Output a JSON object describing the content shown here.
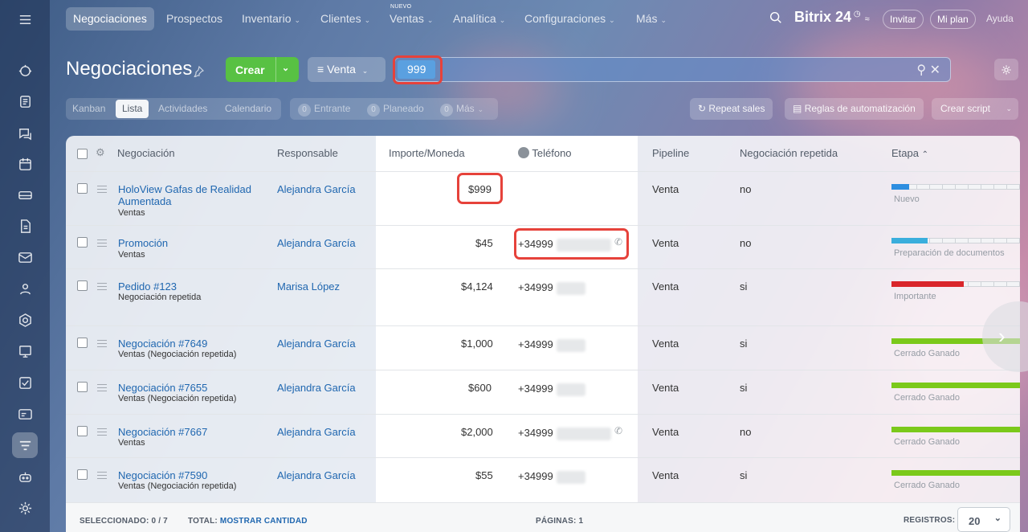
{
  "topnav": {
    "items": [
      {
        "label": "Negociaciones",
        "chevron": false
      },
      {
        "label": "Prospectos",
        "chevron": false
      },
      {
        "label": "Inventario",
        "chevron": true
      },
      {
        "label": "Clientes",
        "chevron": true
      },
      {
        "label": "Ventas",
        "chevron": true,
        "badge": "NUEVO"
      },
      {
        "label": "Analítica",
        "chevron": true
      },
      {
        "label": "Configuraciones",
        "chevron": true
      },
      {
        "label": "Más",
        "chevron": true
      }
    ],
    "brand": "Bitrix 24",
    "invite": "Invitar",
    "plan": "Mi plan",
    "help": "Ayuda"
  },
  "toolbar": {
    "title": "Negociaciones",
    "create_label": "Crear",
    "pipeline_label": "Venta",
    "search_value": "999"
  },
  "views": {
    "tabs": [
      "Kanban",
      "Lista",
      "Actividades",
      "Calendario"
    ],
    "active": "Lista",
    "counters": [
      {
        "num": "0",
        "label": "Entrante"
      },
      {
        "num": "0",
        "label": "Planeado"
      },
      {
        "num": "0",
        "label": "Más"
      }
    ],
    "repeat_sales": "Repeat sales",
    "automation": "Reglas de automatización",
    "create_script": "Crear script"
  },
  "table": {
    "headers": {
      "deal": "Negociación",
      "responsible": "Responsable",
      "amount": "Importe/Moneda",
      "phone": "Teléfono",
      "pipeline": "Pipeline",
      "repeat": "Negociación repetida",
      "stage": "Etapa"
    },
    "rows": [
      {
        "title": "HoloView Gafas de Realidad",
        "title2": "Aumentada",
        "sub": "Ventas",
        "responsible": "Alejandra García",
        "amount": "$999",
        "phone": "",
        "pipeline": "Venta",
        "repeat": "no",
        "stage": "Nuevo",
        "stage_color": "#2d8ee0",
        "stage_fill": 0.14
      },
      {
        "title": "Promoción",
        "title2": "",
        "sub": "Ventas",
        "responsible": "Alejandra García",
        "amount": "$45",
        "phone": "+34999",
        "pipeline": "Venta",
        "repeat": "no",
        "stage": "Preparación de documentos",
        "stage_color": "#3aaedc",
        "stage_fill": 0.28
      },
      {
        "title": "Pedido #123",
        "title2": "",
        "sub": "Negociación repetida",
        "responsible": "Marisa López",
        "amount": "$4,124",
        "phone": "+34999",
        "pipeline": "Venta",
        "repeat": "si",
        "stage": "Importante",
        "stage_color": "#d9262b",
        "stage_fill": 0.56
      },
      {
        "title": "Negociación #7649",
        "title2": "",
        "sub": "Ventas (Negociación repetida)",
        "responsible": "Alejandra García",
        "amount": "$1,000",
        "phone": "+34999",
        "pipeline": "Venta",
        "repeat": "si",
        "stage": "Cerrado Ganado",
        "stage_color": "#7bc91b",
        "stage_fill": 1
      },
      {
        "title": "Negociación #7655",
        "title2": "",
        "sub": "Ventas (Negociación repetida)",
        "responsible": "Alejandra García",
        "amount": "$600",
        "phone": "+34999",
        "pipeline": "Venta",
        "repeat": "si",
        "stage": "Cerrado Ganado",
        "stage_color": "#7bc91b",
        "stage_fill": 1
      },
      {
        "title": "Negociación #7667",
        "title2": "",
        "sub": "Ventas",
        "responsible": "Alejandra García",
        "amount": "$2,000",
        "phone": "+34999",
        "pipeline": "Venta",
        "repeat": "no",
        "stage": "Cerrado Ganado",
        "stage_color": "#7bc91b",
        "stage_fill": 1
      },
      {
        "title": "Negociación #7590",
        "title2": "",
        "sub": "Ventas (Negociación repetida)",
        "responsible": "Alejandra García",
        "amount": "$55",
        "phone": "+34999",
        "pipeline": "Venta",
        "repeat": "si",
        "stage": "Cerrado Ganado",
        "stage_color": "#7bc91b",
        "stage_fill": 1
      }
    ]
  },
  "footer": {
    "selected_label": "SELECCIONADO:",
    "selected_value": "0 / 7",
    "total_label": "TOTAL:",
    "total_link": "MOSTRAR CANTIDAD",
    "pages": "PÁGINAS: 1",
    "records_label": "REGISTROS:",
    "records_value": "20"
  }
}
